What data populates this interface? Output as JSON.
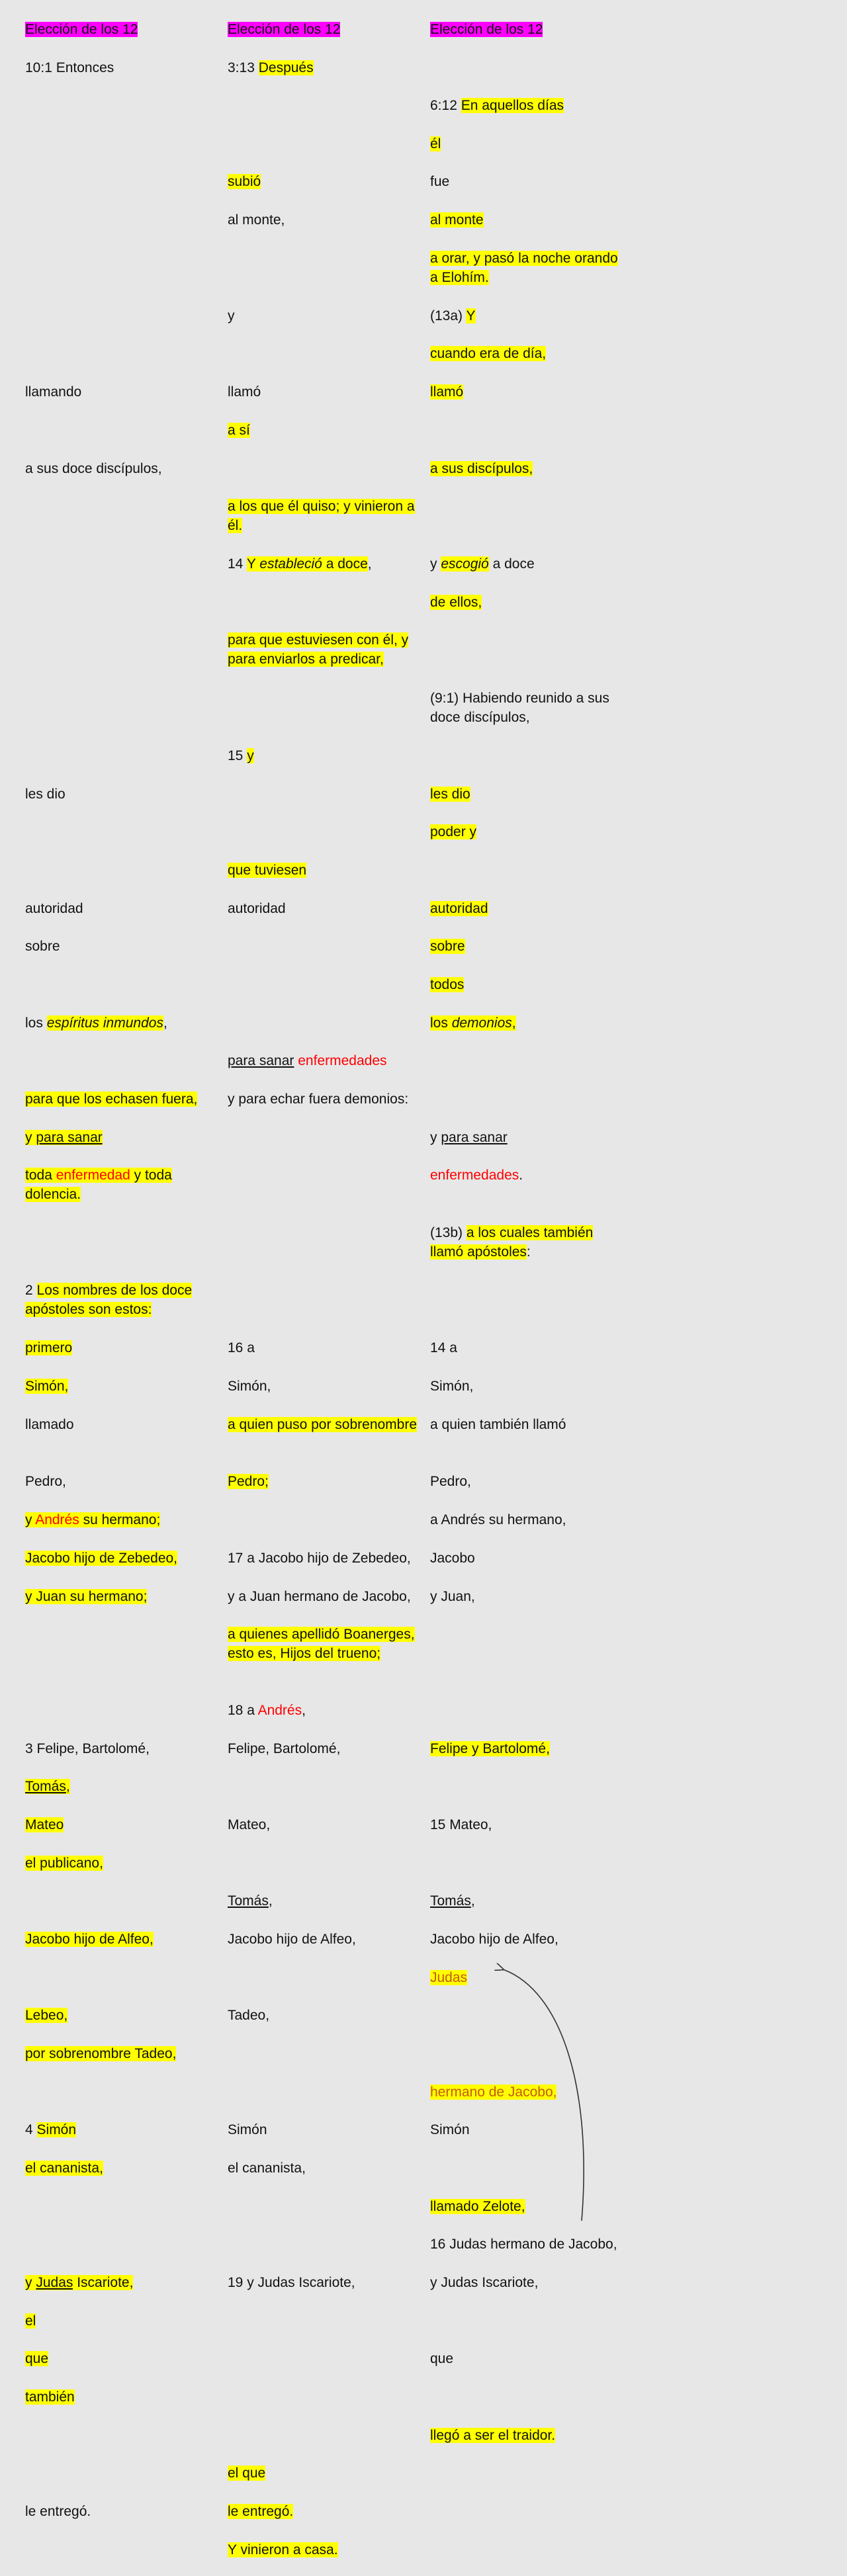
{
  "rows": [
    {
      "a": [
        {
          "t": "Elección de los 12",
          "s": "mg"
        }
      ],
      "b": [
        {
          "t": "Elección de los 12",
          "s": "mg"
        }
      ],
      "c": [
        {
          "t": "Elección de los 12",
          "s": "mg"
        }
      ]
    },
    {
      "a": [
        {
          "t": "10:1 Entonces"
        }
      ],
      "b": [
        {
          "t": "3:13 "
        },
        {
          "t": "Después",
          "s": "hl"
        }
      ],
      "c": []
    },
    {
      "a": [],
      "b": [],
      "c": [
        {
          "t": "6:12 "
        },
        {
          "t": "En aquellos días",
          "s": "hl"
        }
      ]
    },
    {
      "a": [],
      "b": [],
      "c": [
        {
          "t": "él",
          "s": "hl"
        }
      ]
    },
    {
      "a": [],
      "b": [
        {
          "t": "subió",
          "s": "hl"
        }
      ],
      "c": [
        {
          "t": "fue"
        }
      ]
    },
    {
      "a": [],
      "b": [
        {
          "t": "al monte,"
        }
      ],
      "c": [
        {
          "t": "al monte",
          "s": "hl"
        }
      ]
    },
    {
      "a": [],
      "b": [],
      "c": [
        {
          "t": "a orar, y pasó la noche orando a Elohím.",
          "s": "hl"
        }
      ]
    },
    {
      "a": [],
      "b": [
        {
          "t": "y"
        }
      ],
      "c": [
        {
          "t": "(13a) "
        },
        {
          "t": "Y",
          "s": "hl"
        }
      ]
    },
    {
      "a": [],
      "b": [],
      "c": [
        {
          "t": "cuando era de día,",
          "s": "hl"
        }
      ]
    },
    {
      "a": [
        {
          "t": "llamando"
        }
      ],
      "b": [
        {
          "t": "llamó"
        }
      ],
      "c": [
        {
          "t": "llamó",
          "s": "hl"
        }
      ]
    },
    {
      "a": [],
      "b": [
        {
          "t": "a sí",
          "s": "hl"
        }
      ],
      "c": []
    },
    {
      "a": [
        {
          "t": "a sus doce discípulos,"
        }
      ],
      "b": [],
      "c": [
        {
          "t": "a sus discípulos,",
          "s": "hl"
        }
      ]
    },
    {
      "a": [],
      "b": [
        {
          "t": "a los que él quiso; y vinieron a él.",
          "s": "hl"
        }
      ],
      "c": []
    },
    {
      "a": [],
      "b": [
        {
          "t": "14 "
        },
        {
          "t": "Y ",
          "s": "hl"
        },
        {
          "t": "estableció",
          "s": "hl it"
        },
        {
          "t": " a doce",
          "s": "hl"
        },
        {
          "t": ","
        }
      ],
      "c": [
        {
          "t": "y "
        },
        {
          "t": "escogió",
          "s": "hl it"
        },
        {
          "t": " a doce"
        }
      ]
    },
    {
      "a": [],
      "b": [],
      "c": [
        {
          "t": "de ellos,",
          "s": "hl"
        }
      ]
    },
    {
      "a": [],
      "b": [
        {
          "t": "para que estuviesen con él, y para enviarlos a predicar,",
          "s": "hl"
        }
      ],
      "c": []
    },
    {
      "a": [],
      "b": [],
      "c": [
        {
          "t": "(9:1) Habiendo reunido a sus doce discípulos,"
        }
      ]
    },
    {
      "a": [],
      "b": [
        {
          "t": "15 "
        },
        {
          "t": "y",
          "s": "hl"
        }
      ],
      "c": []
    },
    {
      "a": [
        {
          "t": "les dio"
        }
      ],
      "b": [],
      "c": [
        {
          "t": "les dio",
          "s": "hl"
        }
      ]
    },
    {
      "a": [],
      "b": [],
      "c": [
        {
          "t": "poder y",
          "s": "hl"
        }
      ]
    },
    {
      "a": [],
      "b": [
        {
          "t": "que tuviesen",
          "s": "hl"
        }
      ],
      "c": []
    },
    {
      "a": [
        {
          "t": "autoridad"
        }
      ],
      "b": [
        {
          "t": "autoridad"
        }
      ],
      "c": [
        {
          "t": "autoridad",
          "s": "hl"
        }
      ]
    },
    {
      "a": [
        {
          "t": "sobre"
        }
      ],
      "b": [],
      "c": [
        {
          "t": "sobre",
          "s": "hl"
        }
      ]
    },
    {
      "a": [],
      "b": [],
      "c": [
        {
          "t": "todos",
          "s": "hl"
        }
      ]
    },
    {
      "a": [
        {
          "t": "los "
        },
        {
          "t": "espíritus inmundos",
          "s": "hl it"
        },
        {
          "t": ","
        }
      ],
      "b": [],
      "c": [
        {
          "t": "los ",
          "s": "hl"
        },
        {
          "t": "demonios",
          "s": "hl it"
        },
        {
          "t": ",",
          "s": "hl"
        }
      ]
    },
    {
      "a": [],
      "b": [
        {
          "t": "para sanar",
          "s": "ul"
        },
        {
          "t": " "
        },
        {
          "t": "enfermedades",
          "s": "red"
        }
      ],
      "c": []
    },
    {
      "a": [
        {
          "t": "para que los echasen fuera,",
          "s": "hl"
        }
      ],
      "b": [
        {
          "t": "y para echar fuera demonios:"
        }
      ],
      "c": []
    },
    {
      "a": [
        {
          "t": "y ",
          "s": "hl"
        },
        {
          "t": "para sanar",
          "s": "hl ul"
        }
      ],
      "b": [],
      "c": [
        {
          "t": "y "
        },
        {
          "t": "para sanar",
          "s": "ul"
        }
      ]
    },
    {
      "a": [
        {
          "t": "toda ",
          "s": "hl"
        },
        {
          "t": "enfermedad",
          "s": "hl red"
        },
        {
          "t": " y toda dolencia.",
          "s": "hl"
        }
      ],
      "b": [],
      "c": [
        {
          "t": "enfermedades",
          "s": "red"
        },
        {
          "t": "."
        }
      ]
    },
    {
      "a": [],
      "b": [],
      "c": [
        {
          "t": "(13b) "
        },
        {
          "t": "a los cuales también llamó apóstoles",
          "s": "hl"
        },
        {
          "t": ":"
        }
      ]
    },
    {
      "a": [
        {
          "t": "2 "
        },
        {
          "t": "Los nombres de los doce apóstoles son estos:",
          "s": "hl"
        }
      ],
      "b": [],
      "c": []
    },
    {
      "a": [
        {
          "t": "primero",
          "s": "hl"
        }
      ],
      "b": [
        {
          "t": "16 a"
        }
      ],
      "c": [
        {
          "t": "14 a"
        }
      ]
    },
    {
      "a": [
        {
          "t": "Simón,",
          "s": "hl"
        }
      ],
      "b": [
        {
          "t": "Simón,"
        }
      ],
      "c": [
        {
          "t": "Simón,"
        }
      ]
    },
    {
      "a": [
        {
          "t": "llamado"
        }
      ],
      "b": [
        {
          "t": "a quien puso por sobrenombre",
          "s": "hl"
        }
      ],
      "c": [
        {
          "t": "a quien también llamó"
        }
      ]
    },
    {
      "a": [
        {
          "t": "Pedro,"
        }
      ],
      "b": [
        {
          "t": "Pedro;",
          "s": "hl"
        }
      ],
      "c": [
        {
          "t": "Pedro,"
        }
      ]
    },
    {
      "a": [
        {
          "t": "y ",
          "s": "hl"
        },
        {
          "t": "Andrés",
          "s": "hl red"
        },
        {
          "t": " su hermano;",
          "s": "hl"
        }
      ],
      "b": [],
      "c": [
        {
          "t": "a Andrés su hermano,"
        }
      ]
    },
    {
      "a": [
        {
          "t": "Jacobo hijo de Zebedeo,",
          "s": "hl"
        }
      ],
      "b": [
        {
          "t": "17 a Jacobo hijo de Zebedeo,"
        }
      ],
      "c": [
        {
          "t": "Jacobo"
        }
      ]
    },
    {
      "a": [
        {
          "t": "y Juan su hermano;",
          "s": "hl"
        }
      ],
      "b": [
        {
          "t": "y a Juan hermano de Jacobo,"
        }
      ],
      "c": [
        {
          "t": "y Juan,"
        }
      ]
    },
    {
      "a": [],
      "b": [
        {
          "t": "a quienes apellidó Boanerges, esto es, Hijos del trueno;",
          "s": "hl"
        }
      ],
      "c": []
    },
    {
      "a": [],
      "b": [
        {
          "t": "18 a "
        },
        {
          "t": "Andrés",
          "s": "red"
        },
        {
          "t": ","
        }
      ],
      "c": []
    },
    {
      "a": [
        {
          "t": "3 Felipe, Bartolomé,"
        }
      ],
      "b": [
        {
          "t": "Felipe, Bartolomé,"
        }
      ],
      "c": [
        {
          "t": "Felipe y Bartolomé,",
          "s": "hl"
        }
      ]
    },
    {
      "a": [
        {
          "t": "Tomás",
          "s": "hl ul"
        },
        {
          "t": ",",
          "s": "hl"
        }
      ],
      "b": [],
      "c": []
    },
    {
      "a": [
        {
          "t": "Mateo",
          "s": "hl"
        }
      ],
      "b": [
        {
          "t": "Mateo,"
        }
      ],
      "c": [
        {
          "t": "15 Mateo,"
        }
      ]
    },
    {
      "a": [
        {
          "t": "el publicano,",
          "s": "hl"
        }
      ],
      "b": [],
      "c": []
    },
    {
      "a": [],
      "b": [
        {
          "t": "Tomás",
          "s": "ul"
        },
        {
          "t": ","
        }
      ],
      "c": [
        {
          "t": "Tomás",
          "s": "ul"
        },
        {
          "t": ","
        }
      ]
    },
    {
      "a": [
        {
          "t": "Jacobo hijo de Alfeo,",
          "s": "hl"
        }
      ],
      "b": [
        {
          "t": "Jacobo hijo de Alfeo,"
        }
      ],
      "c": [
        {
          "t": "Jacobo hijo de Alfeo,"
        }
      ]
    },
    {
      "a": [],
      "b": [],
      "c": [
        {
          "t": "Judas",
          "s": "hl orng"
        }
      ]
    },
    {
      "a": [
        {
          "t": "Lebeo,",
          "s": "hl"
        }
      ],
      "b": [
        {
          "t": "Tadeo,"
        }
      ],
      "c": []
    },
    {
      "a": [
        {
          "t": "por sobrenombre Tadeo,",
          "s": "hl"
        }
      ],
      "b": [],
      "c": []
    },
    {
      "a": [],
      "b": [],
      "c": [
        {
          "t": "hermano de Jacobo,",
          "s": "hl orng"
        }
      ]
    },
    {
      "a": [
        {
          "t": "4 "
        },
        {
          "t": "Simón",
          "s": "hl"
        }
      ],
      "b": [
        {
          "t": "Simón"
        }
      ],
      "c": [
        {
          "t": "Simón"
        }
      ]
    },
    {
      "a": [
        {
          "t": "el cananista,",
          "s": "hl"
        }
      ],
      "b": [
        {
          "t": "el cananista,"
        }
      ],
      "c": []
    },
    {
      "a": [],
      "b": [],
      "c": [
        {
          "t": "llamado Zelote,",
          "s": "hl"
        }
      ]
    },
    {
      "a": [],
      "b": [],
      "c": [
        {
          "t": "16 Judas hermano de Jacobo,"
        }
      ]
    },
    {
      "a": [
        {
          "t": "y ",
          "s": "hl"
        },
        {
          "t": "Judas",
          "s": "hl ul"
        },
        {
          "t": " Iscariote,",
          "s": "hl"
        }
      ],
      "b": [
        {
          "t": "19 y Judas Iscariote,"
        }
      ],
      "c": [
        {
          "t": "y Judas Iscariote,"
        }
      ]
    },
    {
      "a": [
        {
          "t": "el",
          "s": "hl"
        }
      ],
      "b": [],
      "c": []
    },
    {
      "a": [
        {
          "t": "que",
          "s": "hl"
        }
      ],
      "b": [],
      "c": [
        {
          "t": "que"
        }
      ]
    },
    {
      "a": [
        {
          "t": "también",
          "s": "hl"
        }
      ],
      "b": [],
      "c": []
    },
    {
      "a": [],
      "b": [],
      "c": [
        {
          "t": "llegó a ser el traidor.",
          "s": "hl"
        }
      ]
    },
    {
      "a": [],
      "b": [
        {
          "t": "el que",
          "s": "hl"
        }
      ],
      "c": []
    },
    {
      "a": [
        {
          "t": "le entregó."
        }
      ],
      "b": [
        {
          "t": "le entregó.",
          "s": "hl"
        }
      ],
      "c": []
    },
    {
      "a": [],
      "b": [
        {
          "t": "Y vinieron a casa.",
          "s": "hl"
        }
      ],
      "c": []
    }
  ]
}
